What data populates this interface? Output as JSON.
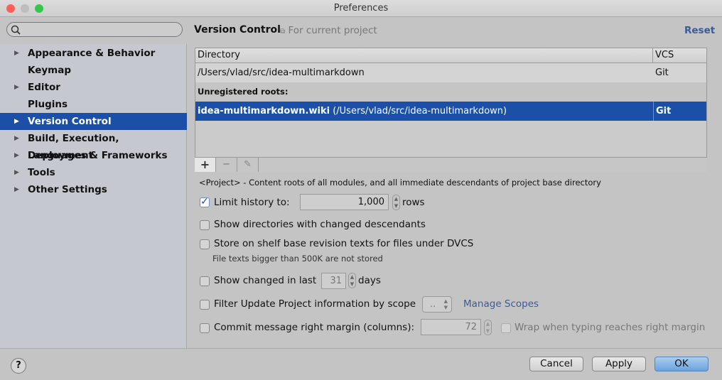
{
  "window": {
    "title": "Preferences"
  },
  "search": {
    "placeholder": ""
  },
  "sidebar": {
    "items": [
      {
        "label": "Appearance & Behavior",
        "expandable": true
      },
      {
        "label": "Keymap",
        "expandable": false
      },
      {
        "label": "Editor",
        "expandable": true
      },
      {
        "label": "Plugins",
        "expandable": false
      },
      {
        "label": "Version Control",
        "expandable": true,
        "selected": true
      },
      {
        "label": "Build, Execution, Deployment",
        "expandable": true
      },
      {
        "label": "Languages & Frameworks",
        "expandable": true
      },
      {
        "label": "Tools",
        "expandable": true
      },
      {
        "label": "Other Settings",
        "expandable": true
      }
    ]
  },
  "header": {
    "title": "Version Control",
    "scope": "For current project",
    "reset": "Reset"
  },
  "table": {
    "columns": [
      "Directory",
      "VCS"
    ],
    "rows": [
      {
        "directory": "/Users/vlad/src/idea-multimarkdown",
        "vcs": "Git"
      }
    ],
    "group_label": "Unregistered roots:",
    "unregistered": [
      {
        "name": "idea-multimarkdown.wiki",
        "path": "(/Users/vlad/src/idea-multimarkdown)",
        "vcs": "Git"
      }
    ],
    "toolbar": {
      "add": "+",
      "remove": "−",
      "edit": "✎"
    }
  },
  "note": "<Project> - Content roots of all modules, and all immediate descendants of project base directory",
  "options": {
    "limit_history": {
      "label": "Limit history to:",
      "checked": true,
      "value": "1,000",
      "unit": "rows"
    },
    "show_dirs": {
      "label": "Show directories with changed descendants",
      "checked": false
    },
    "store_shelf": {
      "label": "Store on shelf base revision texts for files under DVCS",
      "checked": false,
      "hint": "File texts bigger than 500K are not stored"
    },
    "show_changed": {
      "label": "Show changed in last",
      "checked": false,
      "value": "31",
      "unit": "days"
    },
    "filter_update": {
      "label": "Filter Update Project information by scope",
      "checked": false,
      "select": "..",
      "link": "Manage Scopes"
    },
    "commit_margin": {
      "label": "Commit message right margin (columns):",
      "checked": false,
      "value": "72",
      "wrap_label": "Wrap when typing reaches right margin",
      "wrap_checked": false
    }
  },
  "footer": {
    "help": "?",
    "cancel": "Cancel",
    "apply": "Apply",
    "ok": "OK"
  },
  "colors": {
    "selection": "#1c50a8",
    "link": "#3b5a9a"
  }
}
